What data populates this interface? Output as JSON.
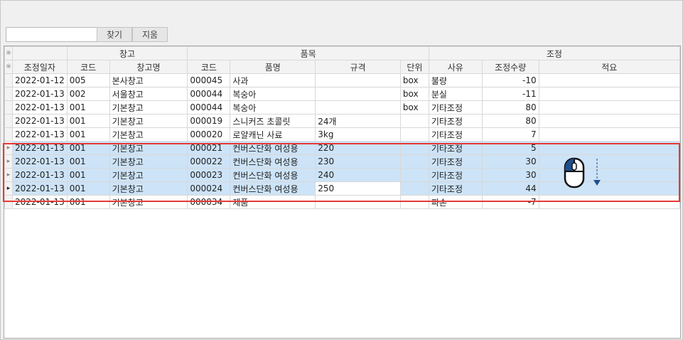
{
  "toolbar": {
    "search_value": "",
    "find_label": "찾기",
    "clear_label": "지움"
  },
  "grid": {
    "group_headers": {
      "warehouse": "창고",
      "item": "품목",
      "adjust": "조정"
    },
    "columns": {
      "date": "조정일자",
      "wh_code": "코드",
      "wh_name": "창고명",
      "item_code": "코드",
      "item_name": "품명",
      "spec": "규격",
      "unit": "단위",
      "reason": "사유",
      "qty": "조정수량",
      "memo": "적요"
    },
    "header_marker": "※",
    "row_marker": "▸",
    "current_marker": "▸",
    "rows": [
      {
        "date": "2022-01-12",
        "wh_code": "005",
        "wh_name": "본사창고",
        "item_code": "000045",
        "item_name": "사과",
        "spec": "",
        "unit": "box",
        "reason": "불량",
        "qty": "-10",
        "memo": ""
      },
      {
        "date": "2022-01-13",
        "wh_code": "002",
        "wh_name": "서울창고",
        "item_code": "000044",
        "item_name": "복숭아",
        "spec": "",
        "unit": "box",
        "reason": "분실",
        "qty": "-11",
        "memo": ""
      },
      {
        "date": "2022-01-13",
        "wh_code": "001",
        "wh_name": "기본창고",
        "item_code": "000044",
        "item_name": "복숭아",
        "spec": "",
        "unit": "box",
        "reason": "기타조정",
        "qty": "80",
        "memo": ""
      },
      {
        "date": "2022-01-13",
        "wh_code": "001",
        "wh_name": "기본창고",
        "item_code": "000019",
        "item_name": "스니커즈 초콜릿",
        "spec": "24개",
        "unit": "",
        "reason": "기타조정",
        "qty": "80",
        "memo": ""
      },
      {
        "date": "2022-01-13",
        "wh_code": "001",
        "wh_name": "기본창고",
        "item_code": "000020",
        "item_name": "로얄캐닌 사료",
        "spec": "3kg",
        "unit": "",
        "reason": "기타조정",
        "qty": "7",
        "memo": ""
      },
      {
        "date": "2022-01-13",
        "wh_code": "001",
        "wh_name": "기본창고",
        "item_code": "000021",
        "item_name": "컨버스단화 여성용",
        "spec": "220",
        "unit": "",
        "reason": "기타조정",
        "qty": "5",
        "memo": ""
      },
      {
        "date": "2022-01-13",
        "wh_code": "001",
        "wh_name": "기본창고",
        "item_code": "000022",
        "item_name": "컨버스단화 여성용",
        "spec": "230",
        "unit": "",
        "reason": "기타조정",
        "qty": "30",
        "memo": ""
      },
      {
        "date": "2022-01-13",
        "wh_code": "001",
        "wh_name": "기본창고",
        "item_code": "000023",
        "item_name": "컨버스단화 여성용",
        "spec": "240",
        "unit": "",
        "reason": "기타조정",
        "qty": "30",
        "memo": ""
      },
      {
        "date": "2022-01-13",
        "wh_code": "001",
        "wh_name": "기본창고",
        "item_code": "000024",
        "item_name": "컨버스단화 여성용",
        "spec": "250",
        "unit": "",
        "reason": "기타조정",
        "qty": "44",
        "memo": ""
      },
      {
        "date": "2022-01-13",
        "wh_code": "001",
        "wh_name": "기본창고",
        "item_code": "000034",
        "item_name": "제품",
        "spec": "",
        "unit": "",
        "reason": "파손",
        "qty": "-7",
        "memo": ""
      }
    ]
  },
  "colors": {
    "selection": "#cde3f7",
    "highlight_border": "#e53935",
    "mouse_accent": "#1f4e8c"
  },
  "icons": {
    "mouse": "mouse-scroll-icon",
    "arrow": "scroll-down-arrow-icon"
  }
}
